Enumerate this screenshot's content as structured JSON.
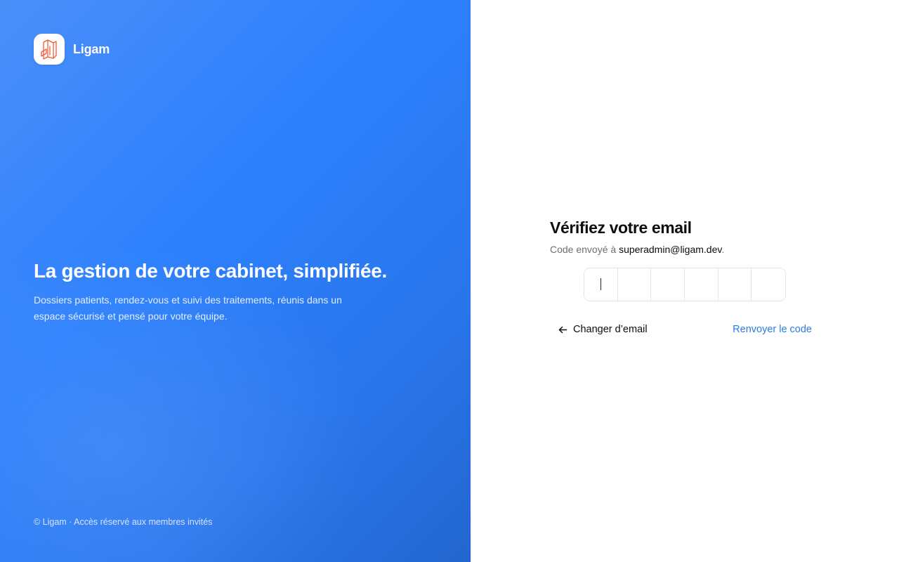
{
  "brand": {
    "name": "Ligam",
    "logo_icon": "ligam-logo-icon",
    "logo_color": "#f05a3c"
  },
  "hero": {
    "title": "La gestion de votre cabinet, simplifiée.",
    "description": "Dossiers patients, rendez-vous et suivi des traitements, réunis dans un espace sécurisé et pensé pour votre équipe."
  },
  "footer": {
    "text": "© Ligam · Accès réservé aux membres invités"
  },
  "verify": {
    "title": "Vérifiez votre email",
    "sent_prefix": "Code envoyé à ",
    "email": "superadmin@ligam.dev",
    "sent_suffix": ".",
    "otp_values": [
      "",
      "",
      "",
      "",
      "",
      ""
    ],
    "change_email_label": "Changer d’email",
    "resend_label": "Renvoyer le code"
  },
  "colors": {
    "primary": "#2d80fd",
    "link": "#2c7be5",
    "text": "#0c0d10",
    "muted": "#6b6f76"
  }
}
